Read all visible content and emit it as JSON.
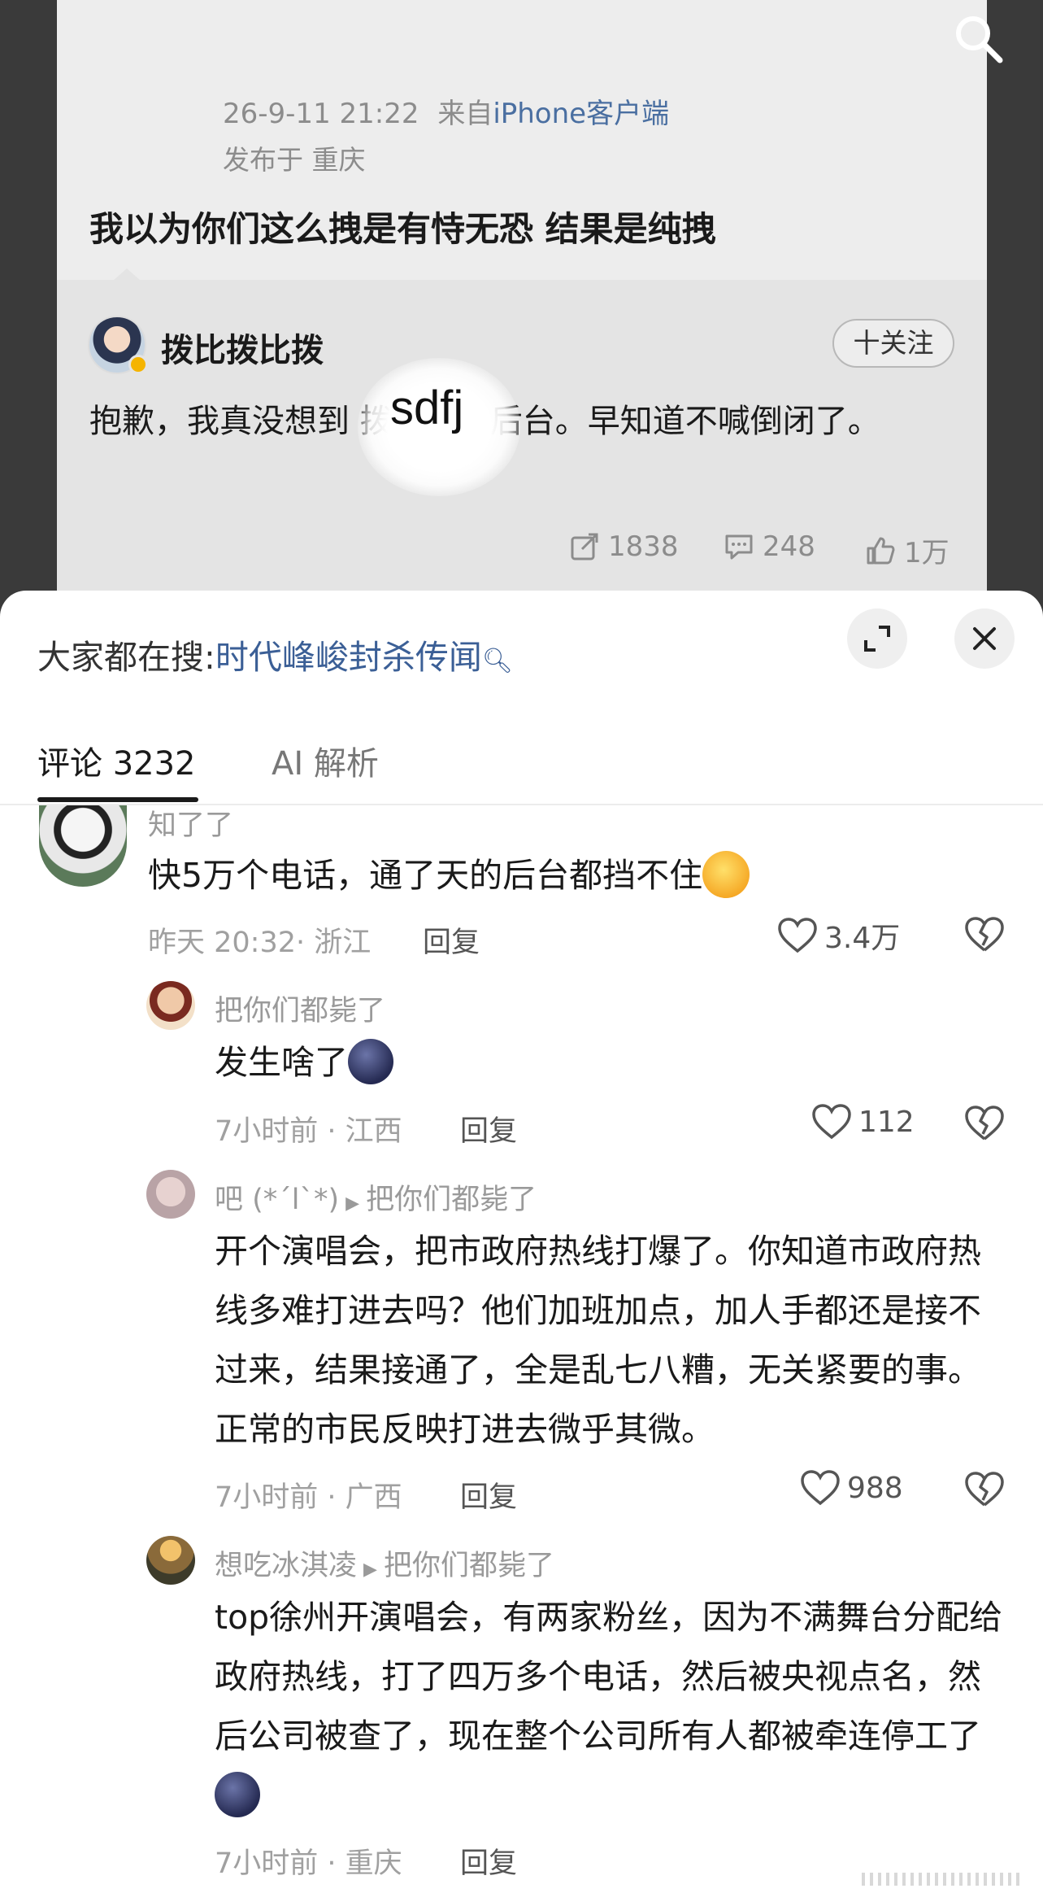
{
  "post": {
    "time": "26-9-11 21:22",
    "from_prefix": "来自",
    "source": "iPhone客户端",
    "location": "发布于 重庆",
    "text": "我以为你们这么拽是有恃无恐 结果是纯拽"
  },
  "repost": {
    "author": "拨比拨比拨",
    "follow_label": "十关注",
    "text": "抱歉，我真没想到        拨这么没后台。早知道不喊倒闭了。",
    "overlay_label": "sdfj",
    "shares": "1838",
    "comments": "248",
    "likes": "1万"
  },
  "sheet": {
    "hot_prefix": "大家都在搜:",
    "hot_keyword": "时代峰峻封杀传闻",
    "tabs": [
      {
        "label": "评论 3232"
      },
      {
        "label": "AI 解析"
      }
    ]
  },
  "comments": [
    {
      "user": "知了了",
      "text": "快5万个电话，通了天的后台都挡不住",
      "meta": "昨天 20:32· 浙江",
      "reply_label": "回复",
      "likes": "3.4万"
    },
    {
      "user": "把你们都毙了",
      "text": "发生啥了",
      "meta": "7小时前 · 江西",
      "reply_label": "回复",
      "likes": "112"
    },
    {
      "user": "吧 (*´l`*)",
      "reply_to": "把你们都毙了",
      "text": "开个演唱会，把市政府热线打爆了。你知道市政府热线多难打进去吗？他们加班加点，加人手都还是接不过来，结果接通了，全是乱七八糟，无关紧要的事。正常的市民反映打进去微乎其微。",
      "meta": "7小时前 · 广西",
      "reply_label": "回复",
      "likes": "988"
    },
    {
      "user": "想吃冰淇凌",
      "reply_to": "把你们都毙了",
      "text": "top徐州开演唱会，有两家粉丝，因为不满舞台分配给政府热线，打了四万多个电话，然后被央视点名，然后公司被查了，现在整个公司所有人都被牵连停工了",
      "meta": "7小时前 · 重庆",
      "reply_label": "回复"
    }
  ]
}
